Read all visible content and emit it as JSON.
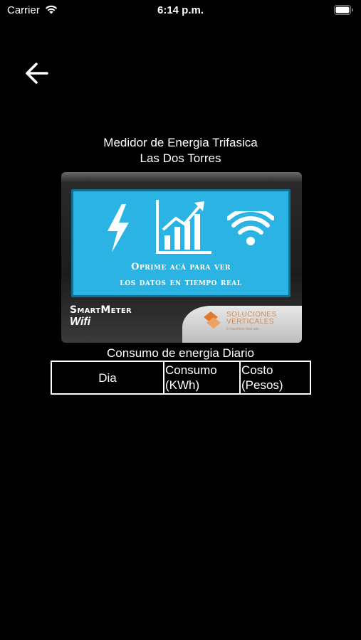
{
  "status_bar": {
    "carrier": "Carrier",
    "time": "6:14 p.m."
  },
  "nav": {
    "back_icon": "arrow-left-icon"
  },
  "header": {
    "title_line1": "Medidor de Energia Trifasica",
    "title_line2": "Las Dos Torres"
  },
  "meter_banner": {
    "line1": "Oprime acá para ver",
    "line2": "los datos en tiempo real",
    "brand_line1": "SmartMeter",
    "brand_line2": "Wifi",
    "company_name_line1": "SOLUCIONES",
    "company_name_line2": "VERTICALES",
    "company_tagline": "lo hacemos más alto",
    "icons": [
      "lightning-icon",
      "chart-growth-icon",
      "wifi-icon"
    ],
    "screen_color": "#2bb3e3"
  },
  "consumption": {
    "title": "Consumo de energia Diario",
    "columns": [
      {
        "line1": "Dia",
        "line2": ""
      },
      {
        "line1": "Consumo",
        "line2": "(KWh)"
      },
      {
        "line1": "Costo",
        "line2": "(Pesos)"
      }
    ]
  }
}
